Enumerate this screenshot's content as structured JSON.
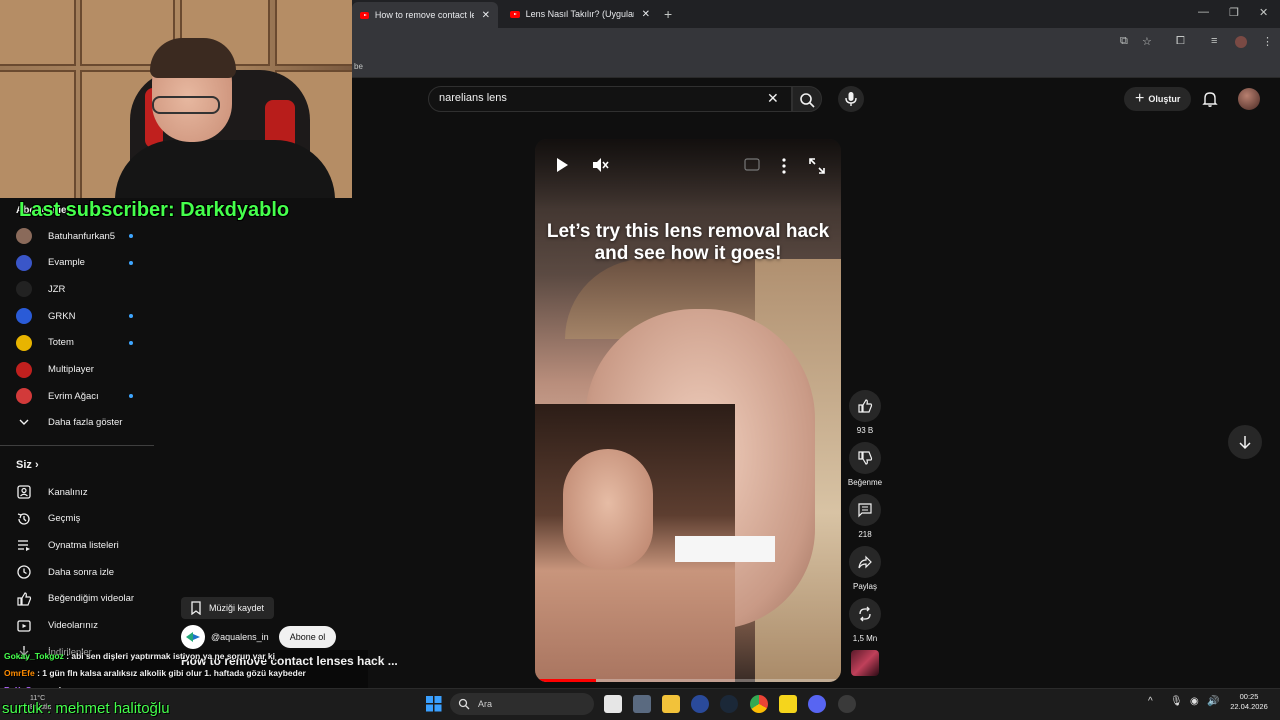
{
  "browser": {
    "tabs": [
      {
        "title": "How to remove contact lenses",
        "active": true
      },
      {
        "title": "Lens Nasıl Takılır? (Uygulamalı A",
        "active": false
      }
    ],
    "bookmark_fragment": "be"
  },
  "stream_overlay": {
    "last_subscriber": "Last subscriber: Darkdyablo",
    "bottom_text": "surtuk : mehmet halitoğlu"
  },
  "header": {
    "search_value": "narelians lens",
    "create_label": "Oluştur"
  },
  "sidebar": {
    "subscriptions_heading": "Abonelikler",
    "subscriptions": [
      {
        "name": "Batuhanfurkan5",
        "dot": true,
        "color": "#8a6a5a"
      },
      {
        "name": "Evample",
        "dot": true,
        "color": "#3a56c8"
      },
      {
        "name": "JZR",
        "dot": false,
        "color": "#222222"
      },
      {
        "name": "GRKN",
        "dot": true,
        "color": "#2a5bd7"
      },
      {
        "name": "Totem",
        "dot": true,
        "color": "#e8b400"
      },
      {
        "name": "Multiplayer",
        "dot": false,
        "color": "#c0201e"
      },
      {
        "name": "Evrim Ağacı",
        "dot": true,
        "color": "#d23a3a"
      }
    ],
    "show_more": "Daha fazla göster",
    "you_heading": "Siz",
    "you_items": [
      {
        "label": "Kanalınız",
        "icon": "channel-icon"
      },
      {
        "label": "Geçmiş",
        "icon": "history-icon"
      },
      {
        "label": "Oynatma listeleri",
        "icon": "playlists-icon"
      },
      {
        "label": "Daha sonra izle",
        "icon": "watch-later-icon"
      },
      {
        "label": "Beğendiğim videolar",
        "icon": "liked-icon"
      },
      {
        "label": "Videolarınız",
        "icon": "your-videos-icon"
      },
      {
        "label": "İndirilenler",
        "icon": "downloads-icon"
      }
    ]
  },
  "short": {
    "caption": "Let’s try this lens removal hack and see how it goes!",
    "progress": 0.2,
    "title": "How to remove contact lenses hack ...",
    "channel": "@aqualens_in",
    "subscribe_label": "Abone ol",
    "save_music_label": "Müziği kaydet"
  },
  "actions": {
    "likes": "93 B",
    "dislike_label": "Beğenme",
    "comments": "218",
    "share_label": "Paylaş",
    "remix_count": "1,5 Mn"
  },
  "chat": [
    {
      "user": "Gokay_Tokgoz",
      "user_color": "#45ff4c",
      "message": "abi sen dişleri yaptırmak istiyon ya ne sorun var ki"
    },
    {
      "user": "OmrEfe",
      "user_color": "#ff8c00",
      "message": "1 gün fln kalsa aralıksız alkolik gibi olur 1. haftada gözü kaybeder"
    },
    {
      "user": "BeXuSan",
      "user_color": "#b266ff",
      "message": "yok"
    }
  ],
  "taskbar": {
    "search_placeholder": "Ara",
    "weather_temp": "11°C",
    "weather_desc": "Bulutlu",
    "time": "00:25",
    "date": "22.04.2026"
  }
}
